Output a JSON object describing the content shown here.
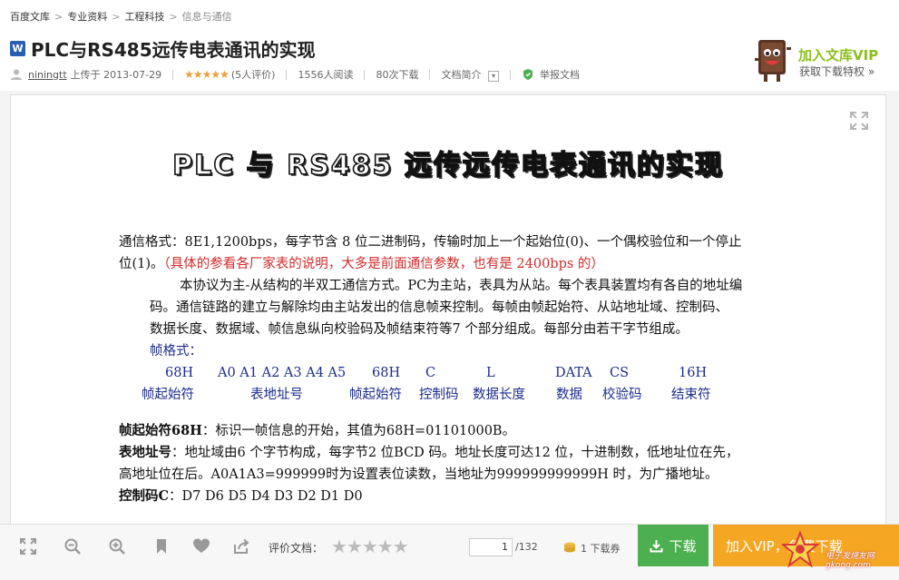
{
  "breadcrumb": [
    "百度文库",
    "专业资料",
    "工程科技",
    "信息与通信"
  ],
  "doc": {
    "icon_letter": "W",
    "title": "PLC与RS485远传电表通讯的实现",
    "author": "niningtt",
    "upload_text": "上传于 2013-07-29",
    "rating_stars": "★★★★★",
    "rating_count": "(5人评价)",
    "reads": "1556人阅读",
    "downloads": "80次下载",
    "summary": "文档简介",
    "report": "举报文档"
  },
  "vip": {
    "title": "加入文库VIP",
    "subtitle": "获取下载特权 »"
  },
  "page": {
    "heading": "PLC 与 RS485 远传远传电表通讯的实现",
    "line1": "通信格式：8E1,1200bps，每字节含 8 位二进制码，传输时加上一个起始位(0)、一个偶校验位和一个停止",
    "line2a": "位(1)。",
    "line2b": "（具体的参看各厂家表的说明，大多是前面通信参数，也有是 2400bps 的）",
    "line3": "本协议为主-从结构的半双工通信方式。PC为主站，表具为从站。每个表具装置均有各自的地址编",
    "line4": "码。通信链路的建立与解除均由主站发出的信息帧来控制。每帧由帧起始符、从站地址域、控制码、",
    "line5": "数据长度、数据域、帧信息纵向校验码及帧结束符等7 个部分组成。每部分由若干字节组成。",
    "frame_label": "帧格式：",
    "frame_codes": [
      "68H",
      "A0  A1  A2  A3  A4  A5",
      "68H",
      "C",
      "L",
      "DATA",
      "CS",
      "16H"
    ],
    "frame_names": [
      "帧起始符",
      "表地址号",
      "帧起始符",
      "控制码",
      "数据长度",
      "数据",
      "校验码",
      "结束符"
    ],
    "p1_bold": "帧起始符68H",
    "p1_text": "：标识一帧信息的开始，其值为68H=01101000B。",
    "p2_bold": "表地址号",
    "p2_text": "：地址域由6 个字节构成，每字节2 位BCD 码。地址长度可达12 位，十进制数，低地址位在先，",
    "p2_line2": "高地址位在后。A0A1A3=999999时为设置表位读数，当地址为999999999999H 时，为广播地址。",
    "p3_bold": "控制码C",
    "p3_text": "：D7 D6 D5 D4 D3 D2 D1 D0"
  },
  "toolbar": {
    "rate_label": "评价文档：",
    "rate_stars": "★★★★★",
    "page_current": "1",
    "page_total": "/132",
    "coupon": "1  下载券",
    "download": "下载",
    "vip_button": "加入VIP，免费下载",
    "watermark": "电子发烧友网 gkong.com"
  },
  "colors": {
    "accent_green": "#4caf50",
    "vip_orange": "#f5a623",
    "vip_title_green": "#8bbf1e",
    "rating_star": "#e9a23b",
    "doc_red": "#d12a2a",
    "doc_blue": "#1c2c8c"
  }
}
